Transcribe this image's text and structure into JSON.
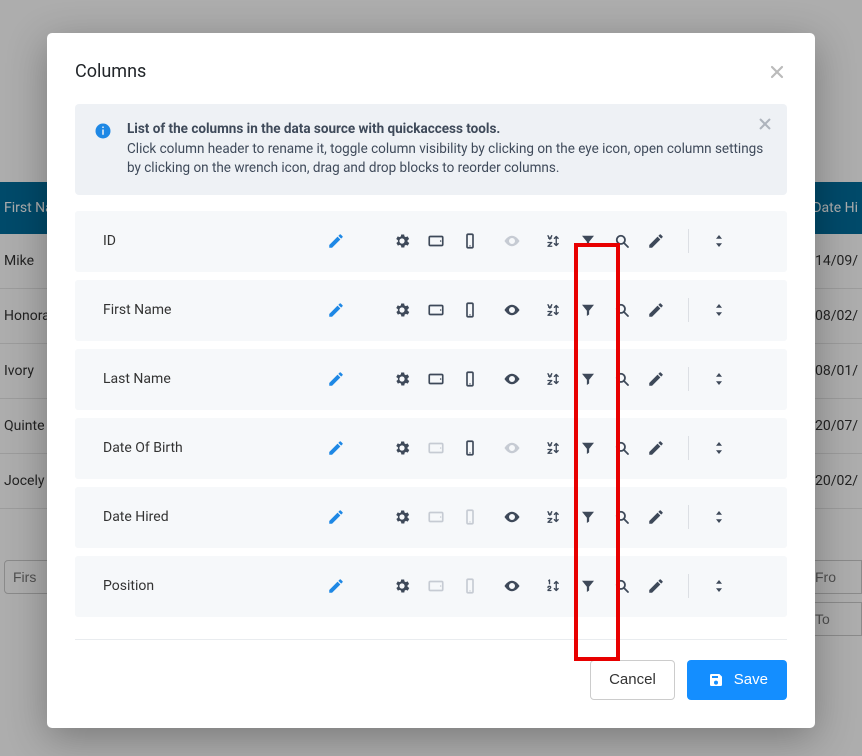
{
  "background": {
    "header_left": "First Na",
    "header_right": "Date Hi",
    "rows": [
      {
        "left": "Mike",
        "right": "14/09/"
      },
      {
        "left": "Honora",
        "right": "08/02/"
      },
      {
        "left": "Ivory",
        "right": "08/01/"
      },
      {
        "left": "Quinte",
        "right": "20/07/"
      },
      {
        "left": "Jocely",
        "right": "20/02/"
      }
    ],
    "filter_left_placeholder": "Firs",
    "filter_right_from_placeholder": "Fro",
    "filter_right_to_placeholder": "To"
  },
  "modal": {
    "title": "Columns",
    "info_bold": "List of the columns in the data source with quickaccess tools.",
    "info_rest": "Click column header to rename it, toggle column visibility by clicking on the eye icon, open column settings by clicking on the wrench icon, drag and drop blocks to reorder columns.",
    "columns": [
      {
        "name": "ID",
        "visible": false,
        "tablet_on": true,
        "mobile_on": true,
        "sort": "az"
      },
      {
        "name": "First Name",
        "visible": true,
        "tablet_on": true,
        "mobile_on": true,
        "sort": "az"
      },
      {
        "name": "Last Name",
        "visible": true,
        "tablet_on": true,
        "mobile_on": true,
        "sort": "az"
      },
      {
        "name": "Date Of Birth",
        "visible": false,
        "tablet_on": false,
        "mobile_on": true,
        "sort": "az"
      },
      {
        "name": "Date Hired",
        "visible": true,
        "tablet_on": false,
        "mobile_on": false,
        "sort": "az"
      },
      {
        "name": "Position",
        "visible": true,
        "tablet_on": false,
        "mobile_on": false,
        "sort": "12"
      }
    ],
    "cancel_label": "Cancel",
    "save_label": "Save"
  }
}
